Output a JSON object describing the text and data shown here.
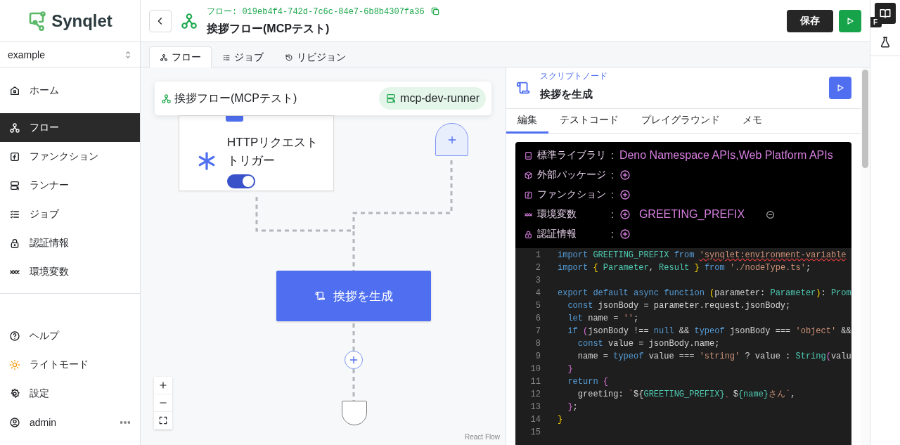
{
  "sidebar": {
    "logo": "Synqlet",
    "workspace": "example",
    "nav": [
      {
        "label": "ホーム",
        "selected": false
      },
      {
        "label": "フロー",
        "selected": true
      },
      {
        "label": "ファンクション",
        "selected": false
      },
      {
        "label": "ランナー",
        "selected": false
      },
      {
        "label": "ジョブ",
        "selected": false
      },
      {
        "label": "認証情報",
        "selected": false
      },
      {
        "label": "環境変数",
        "selected": false
      }
    ],
    "bottom": [
      {
        "label": "ヘルプ"
      },
      {
        "label": "ライトモード"
      },
      {
        "label": "設定"
      }
    ],
    "user": {
      "name": "admin"
    }
  },
  "header": {
    "id_line": "フロー: 019eb4f4-742d-7c6c-84e7-6b8b4307fa36",
    "title": "挨拶フロー(MCPテスト)",
    "save": "保存"
  },
  "tabs": [
    {
      "label": "フロー",
      "selected": true
    },
    {
      "label": "ジョブ",
      "selected": false
    },
    {
      "label": "リビジョン",
      "selected": false
    }
  ],
  "canvas": {
    "info": {
      "title": "挨拶フロー(MCPテスト)",
      "runner": "mcp-dev-runner"
    },
    "nodes": [
      {
        "kind": "trigger",
        "label": "HTTPリクエストトリガー",
        "enabled": true
      },
      {
        "kind": "add"
      },
      {
        "kind": "script",
        "label": "挨拶を生成"
      },
      {
        "kind": "add-circle"
      },
      {
        "kind": "end"
      }
    ],
    "attribution": "React Flow"
  },
  "panel": {
    "kind_label": "スクリプトノード",
    "title": "挨拶を生成",
    "tabs": [
      {
        "label": "編集",
        "selected": true
      },
      {
        "label": "テストコード",
        "selected": false
      },
      {
        "label": "プレイグラウンド",
        "selected": false
      },
      {
        "label": "メモ",
        "selected": false
      }
    ],
    "deps": [
      {
        "label": "標準ライブラリ",
        "sep": ":",
        "addable": false,
        "removable": false,
        "items": [
          "Deno Namespace APIs,Web Platform APIs"
        ]
      },
      {
        "label": "外部パッケージ",
        "sep": ":",
        "addable": true
      },
      {
        "label": "ファンクション",
        "sep": ":",
        "addable": true
      },
      {
        "label": "環境変数",
        "sep": ":",
        "addable": true,
        "removable": true,
        "items": [
          "GREETING_PREFIX"
        ]
      },
      {
        "label": "認証情報",
        "sep": ":",
        "addable": true
      }
    ],
    "code": [
      {
        "no": "1",
        "tokens": [
          {
            "kind": "kw",
            "text": "import "
          },
          {
            "kind": "type",
            "text": "GREETING_PREFIX "
          },
          {
            "kind": "kw",
            "text": "from "
          },
          {
            "kind": "error",
            "text": "'synqlet:environment-variable"
          }
        ]
      },
      {
        "no": "2",
        "tokens": [
          {
            "kind": "kw",
            "text": "import "
          },
          {
            "kind": "gold",
            "text": "{ "
          },
          {
            "kind": "type",
            "text": "Parameter"
          },
          {
            "kind": "plain",
            "text": ", "
          },
          {
            "kind": "type",
            "text": "Result "
          },
          {
            "kind": "gold",
            "text": "} "
          },
          {
            "kind": "kw",
            "text": "from "
          },
          {
            "kind": "str",
            "text": "'./nodeType.ts'"
          },
          {
            "kind": "plain",
            "text": ";"
          }
        ]
      },
      {
        "no": "3"
      },
      {
        "no": "4",
        "tokens": [
          {
            "kind": "kw",
            "text": "export default async function "
          },
          {
            "kind": "gold",
            "text": "("
          },
          {
            "kind": "plain",
            "text": "parameter: "
          },
          {
            "kind": "type",
            "text": "Parameter"
          },
          {
            "kind": "gold",
            "text": ")"
          },
          {
            "kind": "plain",
            "text": ": "
          },
          {
            "kind": "type",
            "text": "Prom"
          }
        ]
      },
      {
        "no": "5",
        "tokens": [
          {
            "kind": "kw",
            "text": "  const"
          },
          {
            "kind": "plain",
            "text": " jsonBody = parameter.request.jsonBody;"
          }
        ]
      },
      {
        "no": "6",
        "tokens": [
          {
            "kind": "kw",
            "text": "  let"
          },
          {
            "kind": "plain",
            "text": " name = "
          },
          {
            "kind": "str",
            "text": "''"
          },
          {
            "kind": "plain",
            "text": ";"
          }
        ]
      },
      {
        "no": "7",
        "tokens": [
          {
            "kind": "kw",
            "text": "  if "
          },
          {
            "kind": "purple",
            "text": "("
          },
          {
            "kind": "plain",
            "text": "jsonBody !== "
          },
          {
            "kind": "kw",
            "text": "null"
          },
          {
            "kind": "plain",
            "text": " && "
          },
          {
            "kind": "kw",
            "text": "typeof"
          },
          {
            "kind": "plain",
            "text": " jsonBody === "
          },
          {
            "kind": "str",
            "text": "'object'"
          },
          {
            "kind": "plain",
            "text": " &&"
          }
        ]
      },
      {
        "no": "8",
        "tokens": [
          {
            "kind": "kw",
            "text": "    const"
          },
          {
            "kind": "plain",
            "text": " value = jsonBody.name;"
          }
        ]
      },
      {
        "no": "9",
        "tokens": [
          {
            "kind": "plain",
            "text": "    name = "
          },
          {
            "kind": "kw",
            "text": "typeof"
          },
          {
            "kind": "plain",
            "text": " value === "
          },
          {
            "kind": "str",
            "text": "'string'"
          },
          {
            "kind": "plain",
            "text": " ? value : "
          },
          {
            "kind": "type",
            "text": "String"
          },
          {
            "kind": "purple",
            "text": "("
          },
          {
            "kind": "plain",
            "text": "valu"
          }
        ]
      },
      {
        "no": "10",
        "tokens": [
          {
            "kind": "purple",
            "text": "  }"
          }
        ]
      },
      {
        "no": "11",
        "tokens": [
          {
            "kind": "kw",
            "text": "  return "
          },
          {
            "kind": "purple",
            "text": "{"
          }
        ]
      },
      {
        "no": "12",
        "tokens": [
          {
            "kind": "plain",
            "text": "    greeting: "
          },
          {
            "kind": "str",
            "text": "`"
          },
          {
            "kind": "plain",
            "text": "${"
          },
          {
            "kind": "type",
            "text": "GREETING_PREFIX}"
          },
          {
            "kind": "str",
            "text": "、"
          },
          {
            "kind": "plain",
            "text": "$"
          },
          {
            "kind": "type",
            "text": "{name}"
          },
          {
            "kind": "str",
            "text": "さん`"
          },
          {
            "kind": "plain",
            "text": ","
          }
        ]
      },
      {
        "no": "13",
        "tokens": [
          {
            "kind": "purple",
            "text": "  }"
          },
          {
            "kind": "plain",
            "text": ";"
          }
        ]
      },
      {
        "no": "14",
        "tokens": [
          {
            "kind": "gold",
            "text": "}"
          }
        ]
      },
      {
        "no": "15"
      }
    ]
  },
  "rail": {
    "badge": "F"
  }
}
